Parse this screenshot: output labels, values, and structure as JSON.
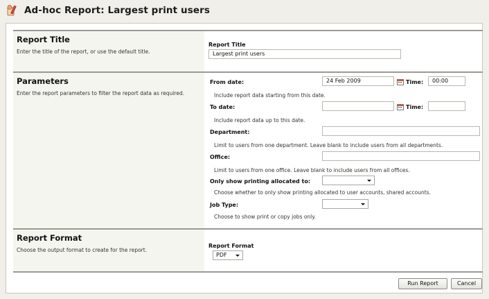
{
  "page": {
    "title": "Ad-hoc Report: Largest print users",
    "icon": "report-wizard-icon"
  },
  "sections": {
    "title": {
      "heading": "Report Title",
      "description": "Enter the title of the report, or use the default title.",
      "field_label": "Report Title",
      "field_value": "Largest print users"
    },
    "parameters": {
      "heading": "Parameters",
      "description": "Enter the report parameters to filter the report data as required.",
      "from_date": {
        "label": "From date:",
        "value": "24 Feb 2009",
        "time_label": "Time:",
        "time_value": "00:00",
        "hint": "Include report data starting from this date."
      },
      "to_date": {
        "label": "To date:",
        "value": "",
        "time_label": "Time:",
        "time_value": "",
        "hint": "Include report data up to this date."
      },
      "department": {
        "label": "Department:",
        "value": "",
        "hint": "Limit to users from one department. Leave blank to include users from all departments."
      },
      "office": {
        "label": "Office:",
        "value": "",
        "hint": "Limit to users from one office. Leave blank to include users from all offices."
      },
      "allocated": {
        "label": "Only show printing allocated to:",
        "value": "",
        "hint": "Choose whether to only show printing allocated to user accounts, shared accounts."
      },
      "job_type": {
        "label": "Job Type:",
        "value": "",
        "hint": "Choose to show print or copy jobs only."
      }
    },
    "format": {
      "heading": "Report Format",
      "description": "Choose the output format to create for the report.",
      "field_label": "Report Format",
      "selected": "PDF"
    }
  },
  "buttons": {
    "run": "Run Report",
    "cancel": "Cancel"
  }
}
